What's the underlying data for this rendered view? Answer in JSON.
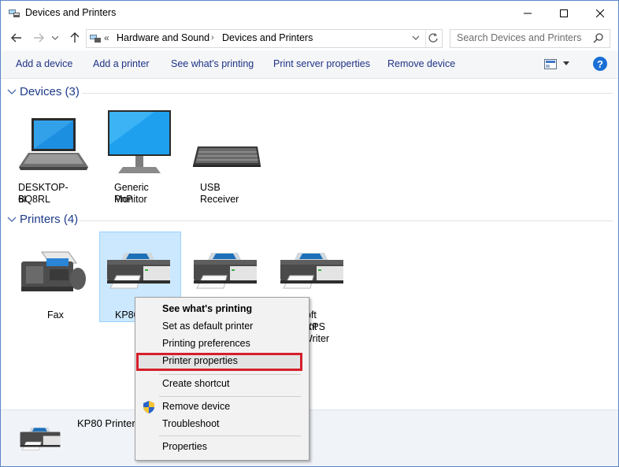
{
  "window": {
    "title": "Devices and Printers"
  },
  "address": {
    "crumbs": [
      "Hardware and Sound",
      "Devices and Printers"
    ],
    "search_placeholder": "Search Devices and Printers"
  },
  "commands": {
    "add_device": "Add a device",
    "add_printer": "Add a printer",
    "see_printing": "See what's printing",
    "print_server": "Print server properties",
    "remove_device": "Remove device",
    "help": "?"
  },
  "groups": {
    "devices": {
      "title": "Devices (3)",
      "items": [
        {
          "line1": "DESKTOP-BQ8RL",
          "line2": "6I",
          "icon": "laptop-icon"
        },
        {
          "line1": "Generic PnP",
          "line2": "Monitor",
          "icon": "monitor-icon"
        },
        {
          "line1": "USB Receiver",
          "line2": "",
          "icon": "keyboard-icon"
        }
      ]
    },
    "printers": {
      "title": "Printers (4)",
      "items": [
        {
          "line1": "Fax",
          "line2": "",
          "icon": "fax-icon"
        },
        {
          "line1": "KP80",
          "line2": "",
          "icon": "printer-icon"
        },
        {
          "line1": "",
          "line2": "",
          "icon": "printer-icon"
        },
        {
          "line1": "oft XPS",
          "line2": "ent Writer",
          "icon": "printer-icon"
        }
      ]
    }
  },
  "details": {
    "name": "KP80 Printer"
  },
  "context_menu": {
    "items": [
      {
        "label": "See what's printing",
        "bold": true
      },
      {
        "label": "Set as default printer"
      },
      {
        "label": "Printing preferences"
      },
      {
        "label": "Printer properties",
        "highlighted": true
      },
      {
        "label": "Create shortcut"
      },
      {
        "label": "Remove device",
        "icon": "uac-shield-icon"
      },
      {
        "label": "Troubleshoot"
      },
      {
        "label": "Properties"
      }
    ]
  },
  "colors": {
    "accent": "#1e3a8a",
    "highlight_border": "#d51f2a",
    "selection": "#cce8ff"
  }
}
